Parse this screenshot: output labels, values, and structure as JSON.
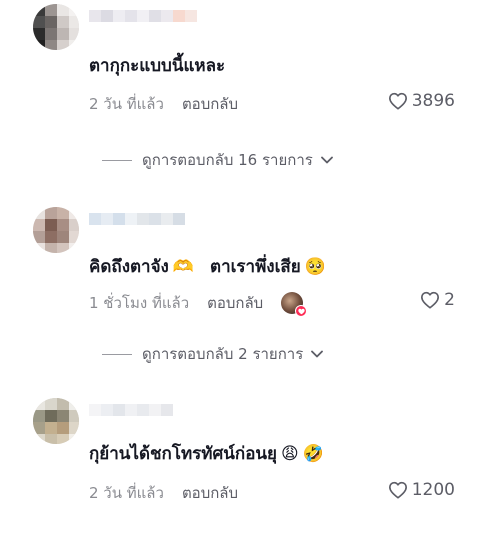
{
  "comments": [
    {
      "text": "ตากุกะแบบนี้แหละ",
      "time": "2 วัน ที่แล้ว",
      "reply_label": "ตอบกลับ",
      "likes": "3896",
      "view_replies": "ดูการตอบกลับ 16 รายการ"
    },
    {
      "text_part1": "คิดถึงตาจัง",
      "text_part2": "ตาเราพึ่งเสีย",
      "emoji1": "🫶",
      "emoji2": "🥺",
      "time": "1 ชั่วโมง ที่แล้ว",
      "reply_label": "ตอบกลับ",
      "likes": "2",
      "view_replies": "ดูการตอบกลับ 2 รายการ"
    },
    {
      "text": "กุย้านได้ชกโทรทัศน์ก่อนยุ",
      "emoji1": "😩",
      "emoji2": "🤣",
      "time": "2 วัน ที่แล้ว",
      "reply_label": "ตอบกลับ",
      "likes": "1200"
    }
  ],
  "icons": {
    "like": "heart-outline-icon",
    "expand": "chevron-down-icon",
    "creator_liked": "heart-badge-icon"
  },
  "colors": {
    "text": "#161823",
    "muted": "#8a8b91",
    "accent": "#fe2c55"
  }
}
